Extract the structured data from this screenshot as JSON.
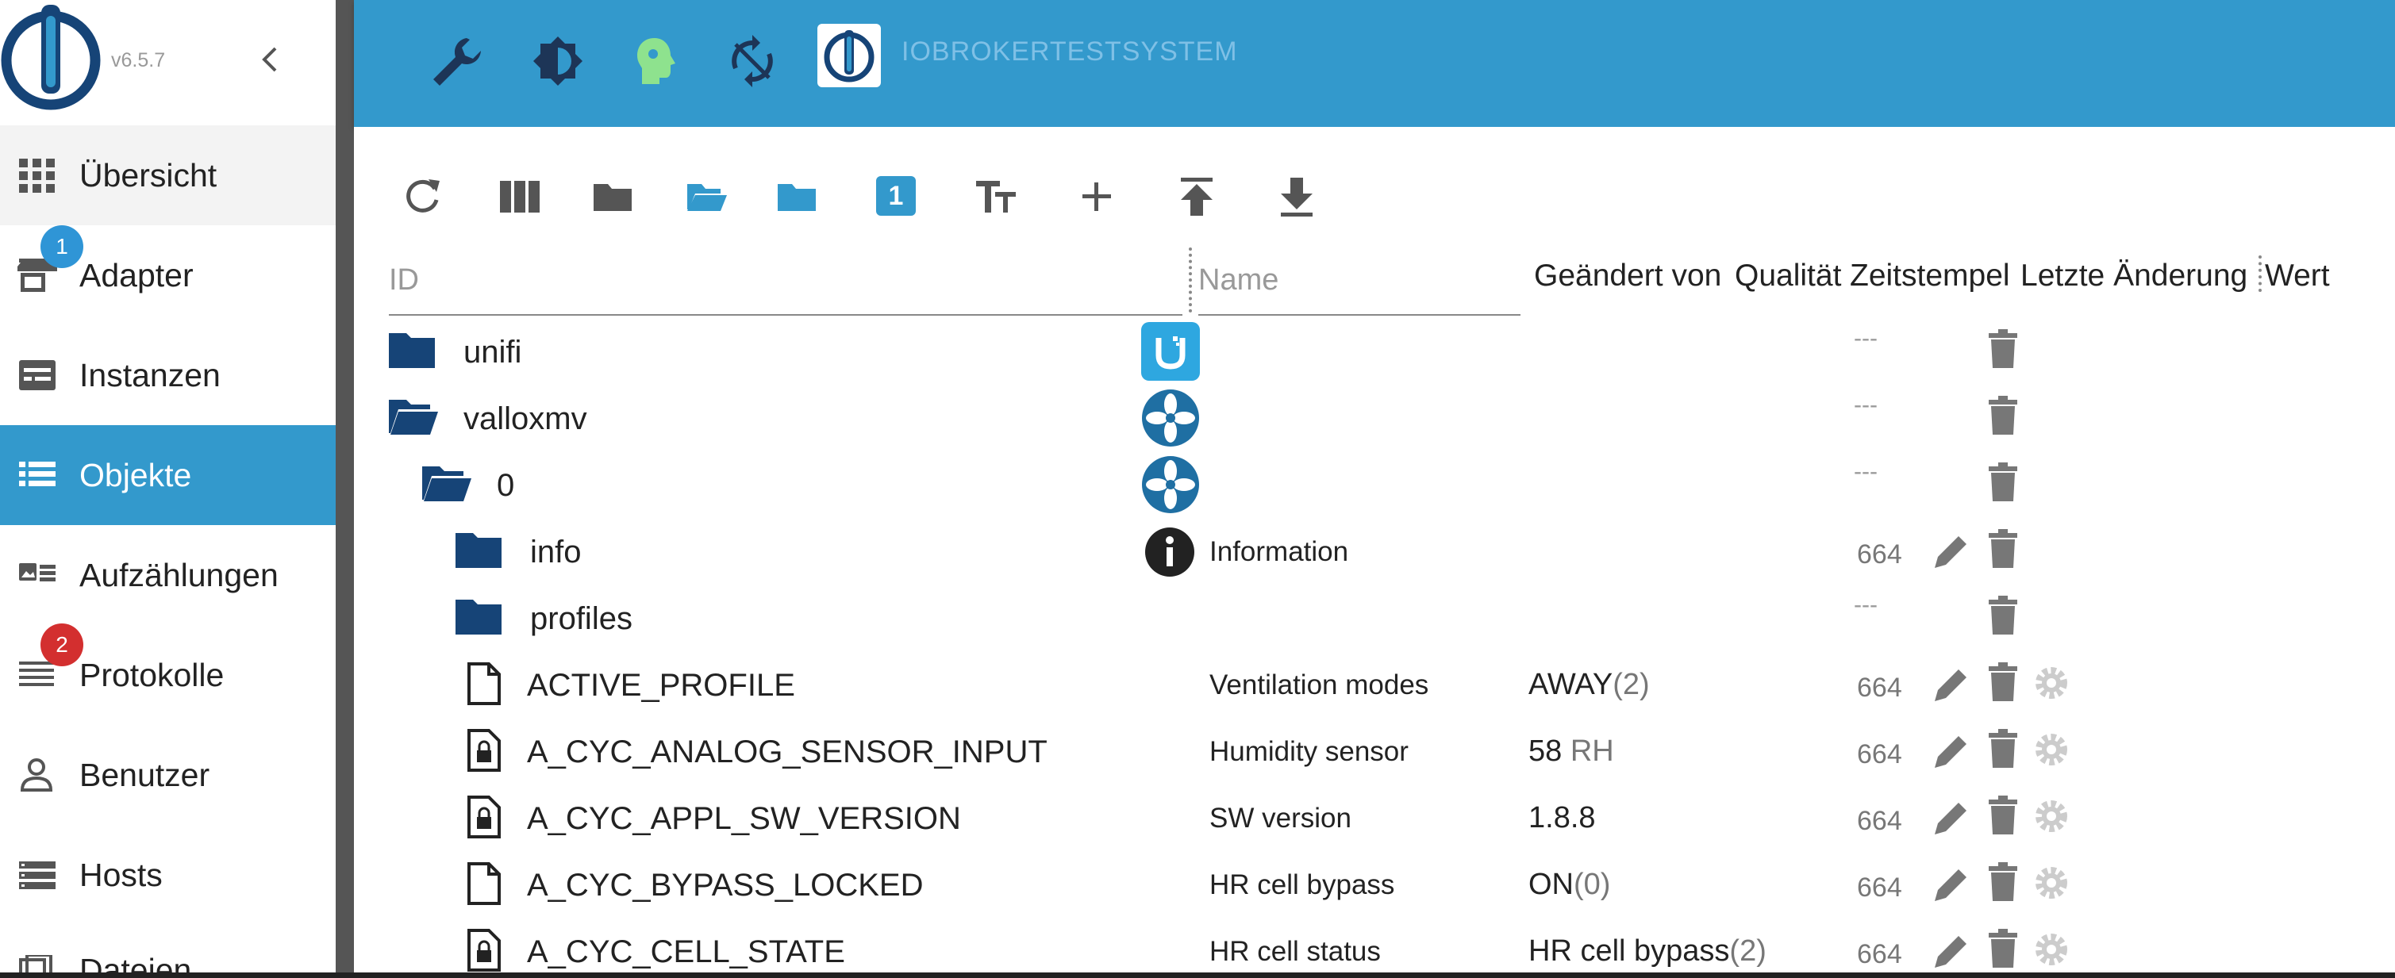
{
  "app": {
    "version": "v6.5.7"
  },
  "sidebar": {
    "items": [
      {
        "label": "Übersicht",
        "icon": "grid-icon"
      },
      {
        "label": "Adapter",
        "icon": "store-icon",
        "badge": "1"
      },
      {
        "label": "Instanzen",
        "icon": "instances-icon"
      },
      {
        "label": "Objekte",
        "icon": "list-icon",
        "active": true
      },
      {
        "label": "Aufzählungen",
        "icon": "enums-icon"
      },
      {
        "label": "Protokolle",
        "icon": "logs-icon",
        "badge": "2"
      },
      {
        "label": "Benutzer",
        "icon": "user-icon"
      },
      {
        "label": "Hosts",
        "icon": "hosts-icon"
      },
      {
        "label": "Dateien",
        "icon": "files-icon"
      }
    ],
    "badge_colors": {
      "adapter": "#2f95d6",
      "protokolle": "#d32f2f"
    }
  },
  "topbar": {
    "title": "IOBROKERTESTSYSTEM",
    "icons": [
      "wrench-icon",
      "theme-icon",
      "expert-mode-icon",
      "restart-icon",
      "iobroker-logo-icon"
    ],
    "color": "#3399cc"
  },
  "toolbar": {
    "icons": [
      "refresh-icon",
      "columns-icon",
      "folder-icon",
      "folder-open-icon",
      "folder-blue-icon",
      "count-badge-icon",
      "text-size-icon",
      "add-icon",
      "upload-icon",
      "download-icon"
    ],
    "count_badge": "1"
  },
  "table": {
    "filters": {
      "id_placeholder": "ID",
      "name_placeholder": "Name"
    },
    "headers": [
      "Geändert von",
      "Qualität",
      "Zeitstempel",
      "Letzte Änderung",
      "Wert"
    ],
    "rows": [
      {
        "id": "unifi",
        "type": "folder",
        "name": "",
        "value": "",
        "acl": "---"
      },
      {
        "id": "valloxmv",
        "type": "folder-open",
        "name": "",
        "value": "",
        "acl": "---"
      },
      {
        "id": "0",
        "type": "folder-open",
        "name": "",
        "value": "",
        "acl": "---"
      },
      {
        "id": "info",
        "type": "folder",
        "name": "Information",
        "value": "",
        "acl": "664"
      },
      {
        "id": "profiles",
        "type": "folder",
        "name": "",
        "value": "",
        "acl": "---"
      },
      {
        "id": "ACTIVE_PROFILE",
        "type": "state",
        "name": "Ventilation modes",
        "value": "AWAY",
        "value_extra": "(2)",
        "acl": "664"
      },
      {
        "id": "A_CYC_ANALOG_SENSOR_INPUT",
        "type": "state-locked",
        "name": "Humidity sensor",
        "value": "58",
        "value_extra": " RH",
        "acl": "664"
      },
      {
        "id": "A_CYC_APPL_SW_VERSION",
        "type": "state-locked",
        "name": "SW version",
        "value": "1.8.8",
        "value_extra": "",
        "acl": "664"
      },
      {
        "id": "A_CYC_BYPASS_LOCKED",
        "type": "state",
        "name": "HR cell bypass",
        "value": "ON",
        "value_extra": "(0)",
        "acl": "664"
      },
      {
        "id": "A_CYC_CELL_STATE",
        "type": "state-locked",
        "name": "HR cell status",
        "value": "HR cell bypass",
        "value_extra": "(2)",
        "acl": "664"
      }
    ]
  }
}
